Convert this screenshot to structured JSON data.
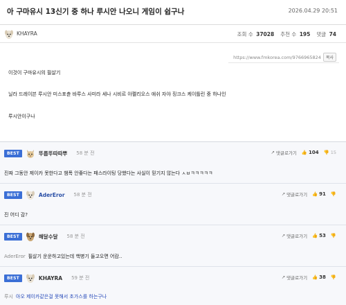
{
  "post": {
    "title": "아 구마유시 13신기 중 하나 루시안 나오니 게임이 쉽구나",
    "date": "2026.04.29 20:51",
    "author": "KHAYRA",
    "views_label": "조회 수",
    "views": "37028",
    "likes_label": "추천 수",
    "likes": "195",
    "comments_label": "댓글",
    "comments": "74",
    "url": "https://www.fmkorea.com/9766965824",
    "copy_label": "복사",
    "body_lines": [
      "이것이 구마유시의 필살기",
      "닐라 드레이븐 루시안 미스포츈 바루스 사미라 세나 시비르 아펠리오스 애쉬 자야 징크스 케이틀린 중 하나인",
      "루시안이구나"
    ]
  },
  "reply_label": "댓글로가기",
  "comments": [
    {
      "badge": "BEST",
      "author": "뚜룹뚜따따뿌",
      "time": "58 분 전",
      "up": "104",
      "down": "15",
      "mention": "",
      "text": "진짜 그동안 제이카 못한다고 챔폭 안좋다는 패스라이팅 당했다는 사실이 믿기지 않는다 ㅅㅂㅋㅋㅋㅋㅋ"
    },
    {
      "badge": "BEST",
      "author": "AderEror",
      "time": "58 분 전",
      "up": "91",
      "down": "",
      "mention": "",
      "text": "진 어디 감?"
    },
    {
      "badge": "BEST",
      "author": "해달수달",
      "time": "58 분 전",
      "up": "53",
      "down": "",
      "mention": "AderEror",
      "text": "필살기 운운하고있는데 핵병기 들고오면 어캄.."
    },
    {
      "badge": "BEST",
      "author": "KHAYRA",
      "time": "59 분 전",
      "up": "38",
      "down": "",
      "mention": "루시",
      "text": "아오 제이카같은걸 못해서 초가스를 하는구나"
    }
  ],
  "colors": {
    "badge": "#3b6fd6",
    "author_highlight": "#2a4fa6",
    "op_text": "#2448b8"
  }
}
